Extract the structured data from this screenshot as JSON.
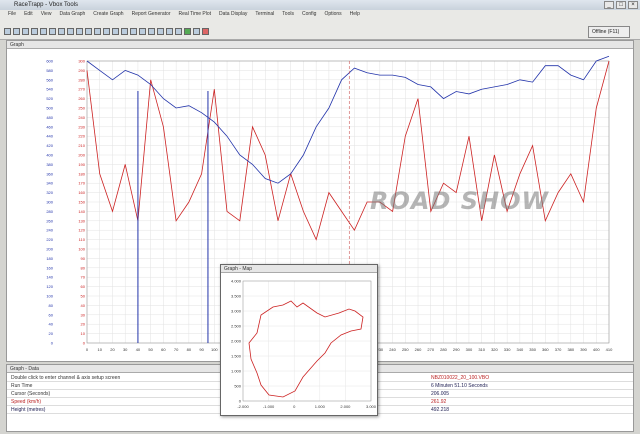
{
  "window": {
    "title": "RaceTrapp - Vbox Tools"
  },
  "menu": [
    "File",
    "Edit",
    "View",
    "Data Graph",
    "Create Graph",
    "Report Generator",
    "Real Time Plot",
    "Data Display",
    "Terminal",
    "Tools",
    "Config",
    "Options",
    "Help"
  ],
  "toolbar": {
    "offline_label": "Offline (F11)"
  },
  "graph_panel": {
    "title": "Graph"
  },
  "chart_data": {
    "type": "line",
    "x": [
      0,
      10,
      20,
      30,
      40,
      50,
      60,
      70,
      80,
      90,
      100,
      110,
      120,
      130,
      140,
      150,
      160,
      170,
      180,
      190,
      200,
      210,
      220,
      230,
      240,
      250,
      260,
      270,
      280,
      290,
      300,
      310,
      320,
      330,
      340,
      350,
      360,
      370,
      380,
      390,
      400,
      410
    ],
    "x_ticks": [
      "0",
      "10",
      "20",
      "30",
      "40",
      "50",
      "60",
      "70",
      "80",
      "90",
      "100",
      "110",
      "120",
      "130",
      "140",
      "150",
      "160",
      "170",
      "180",
      "190",
      "200",
      "210",
      "220",
      "230",
      "240",
      "250",
      "260",
      "270",
      "280",
      "290",
      "300",
      "310",
      "320",
      "330",
      "340",
      "350",
      "360",
      "370",
      "380",
      "390",
      "400",
      "410"
    ],
    "left_ticks": [
      "600",
      "580",
      "560",
      "540",
      "520",
      "500",
      "480",
      "460",
      "440",
      "420",
      "400",
      "380",
      "360",
      "340",
      "320",
      "300",
      "280",
      "260",
      "240",
      "220",
      "200",
      "180",
      "160",
      "140",
      "120",
      "100",
      "80",
      "60",
      "40",
      "20",
      "0"
    ],
    "right_ticks": [
      "300",
      "290",
      "280",
      "270",
      "260",
      "250",
      "240",
      "230",
      "220",
      "210",
      "200",
      "190",
      "180",
      "170",
      "160",
      "150",
      "140",
      "130",
      "120",
      "110",
      "100",
      "90",
      "80",
      "70",
      "60",
      "50",
      "40",
      "30",
      "20",
      "10",
      "0"
    ],
    "series": [
      {
        "name": "Speed (km/h)",
        "color": "#cc2222",
        "values": [
          290,
          180,
          140,
          190,
          130,
          280,
          230,
          130,
          150,
          180,
          270,
          140,
          130,
          230,
          200,
          130,
          180,
          140,
          110,
          160,
          140,
          120,
          150,
          150,
          140,
          220,
          260,
          140,
          170,
          160,
          220,
          130,
          200,
          140,
          180,
          210,
          130,
          160,
          180,
          150,
          250,
          300
        ]
      },
      {
        "name": "Height (metres)",
        "color": "#2233aa",
        "values": [
          600,
          580,
          560,
          580,
          570,
          550,
          520,
          500,
          505,
          490,
          470,
          440,
          400,
          380,
          350,
          340,
          360,
          400,
          460,
          500,
          560,
          585,
          575,
          570,
          570,
          565,
          550,
          545,
          520,
          535,
          530,
          540,
          545,
          550,
          560,
          555,
          590,
          590,
          570,
          560,
          600,
          610
        ]
      }
    ]
  },
  "watermark": "ROAD SHOW",
  "map_window": {
    "title": "Graph - Map",
    "y_ticks": [
      "4.000",
      "3.500",
      "3.000",
      "2.500",
      "2.000",
      "1.500",
      "1.000",
      "500",
      "0"
    ],
    "x_ticks": [
      "-2.000",
      "-1.000",
      "0",
      "1.000",
      "2.000",
      "3.000"
    ]
  },
  "data_panel": {
    "title": "Graph - Data",
    "rows": [
      {
        "key": "Double click to enter channel & axis setup screen",
        "value": "NBZ010022_20_100.VBO"
      },
      {
        "key": "Run Time",
        "value": "6 Minuten 51.10 Seconds"
      },
      {
        "key": "Cursor (Seconds)",
        "value": "206.005"
      },
      {
        "key": "Speed (km/h)",
        "value": "261.92"
      },
      {
        "key": "Height (metres)",
        "value": "492.218"
      }
    ]
  }
}
